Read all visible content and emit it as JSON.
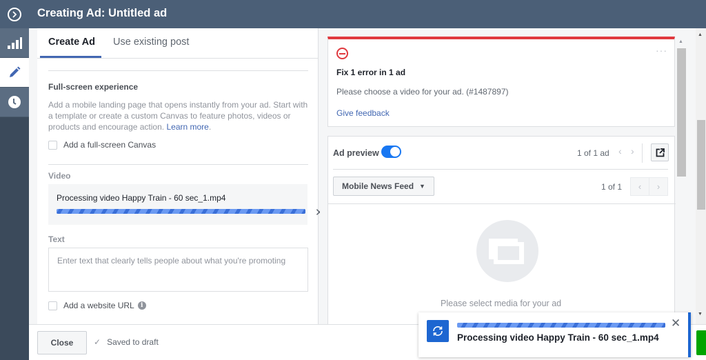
{
  "header": {
    "title": "Creating Ad: Untitled ad",
    "expand_icon": "chevron-right-circle-icon"
  },
  "rail": {
    "items": [
      {
        "name": "performance",
        "icon": "bar-chart-icon",
        "active": false
      },
      {
        "name": "edit",
        "icon": "pencil-icon",
        "active": true
      },
      {
        "name": "history",
        "icon": "clock-icon",
        "active": false
      }
    ]
  },
  "left": {
    "tabs": [
      {
        "label": "Create Ad",
        "active": true
      },
      {
        "label": "Use existing post",
        "active": false
      }
    ],
    "fullscreen": {
      "title": "Full-screen experience",
      "description": "Add a mobile landing page that opens instantly from your ad. Start with a template or create a custom Canvas to feature photos, videos or products and encourage action.",
      "learn_more": "Learn more",
      "checkbox_label": "Add a full-screen Canvas",
      "checked": false
    },
    "video": {
      "label": "Video",
      "processing_text": "Processing video Happy Train - 60 sec_1.mp4",
      "progress_state": "indeterminate"
    },
    "text": {
      "label": "Text",
      "value": "",
      "placeholder": "Enter text that clearly tells people about what you're promoting"
    },
    "website": {
      "checkbox_label": "Add a website URL",
      "checked": false,
      "info_icon": "info-icon"
    }
  },
  "footer": {
    "close_label": "Close",
    "status_text": "Saved to draft",
    "status_icon": "checkmark-icon",
    "accent_color": "#00a400"
  },
  "error": {
    "title": "Fix 1 error in 1 ad",
    "message": "Please choose a video for your ad. (#1487897)",
    "feedback_label": "Give feedback",
    "more_label": "···",
    "accent_color": "#e0393e"
  },
  "preview": {
    "label": "Ad preview",
    "toggle_on": true,
    "ad_count": "1 of 1 ad",
    "prev_arrow": "‹",
    "next_arrow": "›",
    "placement": "Mobile News Feed",
    "placement_count": "1 of 1",
    "empty_message": "Please select media for your ad"
  },
  "toast": {
    "text": "Processing video Happy Train - 60 sec_1.mp4",
    "progress_state": "indeterminate",
    "accent_color": "#1d66d1",
    "icon": "refresh-icon"
  },
  "colors": {
    "header_bg": "#4b5f77",
    "link": "#4267b2"
  }
}
